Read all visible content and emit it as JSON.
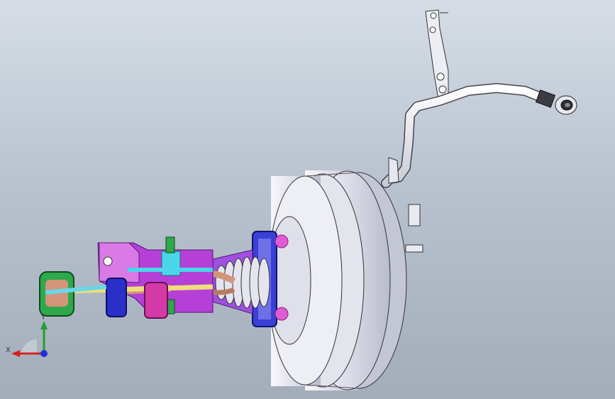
{
  "viewport": {
    "background_top": "#d6dde6",
    "background_bottom": "#a3adba"
  },
  "model": {
    "parts": [
      "brake-booster-housing",
      "master-cylinder-flange",
      "push-rod-bellows",
      "pedal-bracket",
      "mounting-bracket",
      "vacuum-hose",
      "hose-connector",
      "check-valve"
    ],
    "colors": {
      "booster": "#e4e6ef",
      "bracket": "#c34fe0",
      "flange": "#2a2fc9",
      "pads": "#d43aa6",
      "green": "#2ea84a",
      "cyan": "#4ad6e8",
      "copper": "#d2957a"
    }
  },
  "triad": {
    "x_label": "X",
    "y_label": "Y",
    "x_color": "#d42020",
    "y_color": "#20a030",
    "z_color": "#2030d0"
  }
}
